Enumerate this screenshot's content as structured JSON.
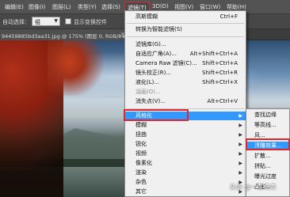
{
  "menubar": {
    "items": [
      "编辑(E)",
      "图像(I)",
      "图层(L)",
      "类型(Y)",
      "选择(S)",
      "滤镜(T)",
      "3D(D)",
      "视图(V)",
      "窗口(W)",
      "帮助(H)"
    ],
    "active_index": 5
  },
  "options_bar": {
    "auto_select_label": "自动选择：",
    "auto_select_value": "组",
    "show_transform_label": "显示变换控件"
  },
  "document_tab": {
    "title": "94459885bd3aa31.jpg @ 175% (图层 0, RGB/8#) *",
    "close": "×"
  },
  "filter_menu": {
    "items": [
      {
        "label": "高斯模糊",
        "shortcut": "Ctrl+F",
        "disabled": false
      },
      {
        "label": "转换为智能滤镜(S)",
        "shortcut": "",
        "disabled": false
      },
      {
        "label": "滤镜库(G)...",
        "shortcut": "",
        "disabled": false
      },
      {
        "label": "自适应广角(A)...",
        "shortcut": "Alt+Shift+Ctrl+A",
        "disabled": false
      },
      {
        "label": "Camera Raw 滤镜(C)...",
        "shortcut": "Shift+Ctrl+A",
        "disabled": false
      },
      {
        "label": "镜头校正(R)...",
        "shortcut": "Shift+Ctrl+R",
        "disabled": false
      },
      {
        "label": "液化(L)...",
        "shortcut": "Shift+Ctrl+X",
        "disabled": false
      },
      {
        "label": "油画(O)...",
        "shortcut": "",
        "disabled": true
      },
      {
        "label": "消失点(V)...",
        "shortcut": "Alt+Ctrl+V",
        "disabled": false
      },
      {
        "label": "风格化",
        "shortcut": "",
        "disabled": false
      },
      {
        "label": "模糊",
        "shortcut": "",
        "disabled": false
      },
      {
        "label": "扭曲",
        "shortcut": "",
        "disabled": false
      },
      {
        "label": "锐化",
        "shortcut": "",
        "disabled": false
      },
      {
        "label": "视频",
        "shortcut": "",
        "disabled": false
      },
      {
        "label": "像素化",
        "shortcut": "",
        "disabled": false
      },
      {
        "label": "渲染",
        "shortcut": "",
        "disabled": false
      },
      {
        "label": "杂色",
        "shortcut": "",
        "disabled": false
      },
      {
        "label": "其它",
        "shortcut": "",
        "disabled": false
      }
    ],
    "submenu_arrow": "▶"
  },
  "stylize_submenu": {
    "items": [
      "查找边缘",
      "等高线...",
      "风...",
      "浮雕效果...",
      "扩散...",
      "拼贴...",
      "曝光过度",
      "凸出..."
    ]
  },
  "watermark": "头条 @一三伤杰",
  "colors": {
    "highlight": "#3399ff",
    "annotation_red": "#e0262d",
    "menu_bg": "#f0f0f0"
  }
}
